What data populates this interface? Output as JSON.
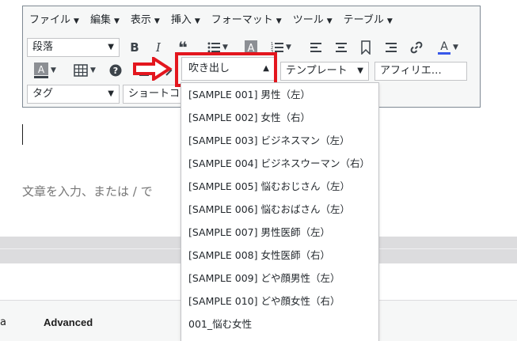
{
  "menubar": {
    "items": [
      "ファイル",
      "編集",
      "表示",
      "挿入",
      "フォーマット",
      "ツール",
      "テーブル"
    ]
  },
  "toolbar": {
    "format_select": "段落",
    "bold": "B",
    "italic": "I",
    "blockquote": "❝",
    "help": "?",
    "bubble_select": "吹き出し",
    "template_select": "テンプレート",
    "affiliate_select": "アフィリエ…",
    "tag_select": "タグ",
    "shortcode_select": "ショートコ"
  },
  "dropdown": {
    "items": [
      "[SAMPLE 001] 男性（左）",
      "[SAMPLE 002] 女性（右）",
      "[SAMPLE 003] ビジネスマン（左）",
      "[SAMPLE 004] ビジネスウーマン（右）",
      "[SAMPLE 005] 悩むおじさん（左）",
      "[SAMPLE 006] 悩むおばさん（左）",
      "[SAMPLE 007] 男性医師（左）",
      "[SAMPLE 008] 女性医師（右）",
      "[SAMPLE 009] どや顔男性（左）",
      "[SAMPLE 010] どや顔女性（右）",
      "001_悩む女性"
    ]
  },
  "editor": {
    "placeholder": "文章を入力、または / で"
  },
  "bottom": {
    "tab_partial": "a",
    "tab_advanced": "Advanced"
  },
  "colors": {
    "highlight": "#e3161e",
    "text_color_bar": "#3858e9"
  }
}
